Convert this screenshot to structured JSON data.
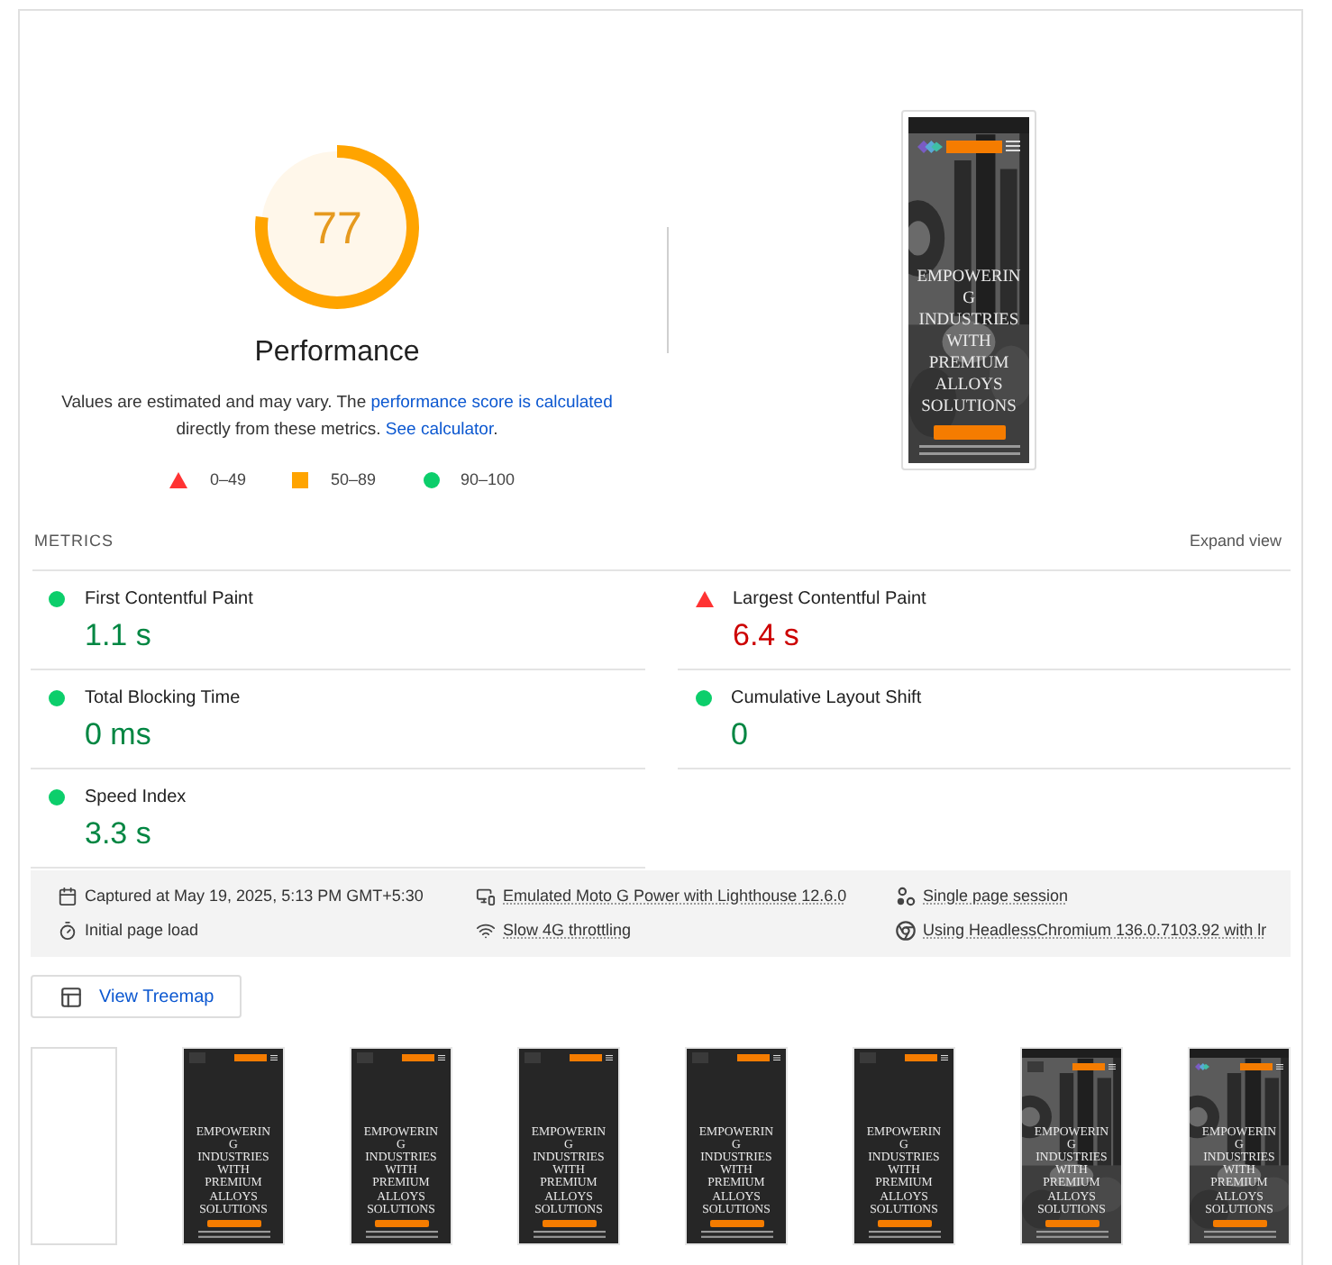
{
  "performance": {
    "score": "77",
    "level": 0.77,
    "title": "Performance",
    "description": {
      "text_before": "Values are estimated and may vary. The ",
      "link_1": "performance score is calculated",
      "text_middle": " directly from these metrics. ",
      "link_2": "See calculator",
      "text_after": "."
    },
    "legend": [
      {
        "kind": "fail",
        "label": "0–49"
      },
      {
        "kind": "average",
        "label": "50–89"
      },
      {
        "kind": "pass",
        "label": "90–100"
      }
    ]
  },
  "screenshot": {
    "logo": true,
    "heading": "EMPOWERIN\nG\nINDUSTRIES\nWITH\nPREMIUM\nALLOYS\nSOLUTIONS"
  },
  "metrics": {
    "title": "METRICS",
    "expand": "Expand view",
    "items": [
      {
        "label": "First Contentful Paint",
        "value": "1.1 s",
        "kind": "pass"
      },
      {
        "label": "Largest Contentful Paint",
        "value": "6.4 s",
        "kind": "fail"
      },
      {
        "label": "Total Blocking Time",
        "value": "0 ms",
        "kind": "pass"
      },
      {
        "label": "Cumulative Layout Shift",
        "value": "0",
        "kind": "pass"
      },
      {
        "label": "Speed Index",
        "value": "3.3 s",
        "kind": "pass"
      }
    ]
  },
  "info": [
    {
      "kind": "calendar",
      "text": "Captured at May 19, 2025, 5:13 PM GMT+5:30",
      "underlined": false
    },
    {
      "kind": "device",
      "text": "Emulated Moto G Power with Lighthouse 12.6.0",
      "underlined": true
    },
    {
      "kind": "nodes",
      "text": "Single page session",
      "underlined": true
    },
    {
      "kind": "timer",
      "text": "Initial page load",
      "underlined": false
    },
    {
      "kind": "wifi",
      "text": "Slow 4G throttling",
      "underlined": true
    },
    {
      "kind": "browser",
      "text": "Using HeadlessChromium 136.0.7103.92 with lr",
      "underlined": true
    }
  ],
  "treemap_button": "View Treemap",
  "filmstrip": [
    {
      "kind": "blank"
    },
    {
      "kind": "dark",
      "logo": false,
      "heading": "EMPOWERIN\nG\nINDUSTRIES\nWITH\nPREMIUM\nALLOYS\nSOLUTIONS"
    },
    {
      "kind": "dark",
      "logo": false,
      "heading": "EMPOWERIN\nG\nINDUSTRIES\nWITH\nPREMIUM\nALLOYS\nSOLUTIONS"
    },
    {
      "kind": "dark",
      "logo": false,
      "heading": "EMPOWERIN\nG\nINDUSTRIES\nWITH\nPREMIUM\nALLOYS\nSOLUTIONS"
    },
    {
      "kind": "dark",
      "logo": false,
      "heading": "EMPOWERIN\nG\nINDUSTRIES\nWITH\nPREMIUM\nALLOYS\nSOLUTIONS"
    },
    {
      "kind": "dark",
      "logo": false,
      "heading": "EMPOWERIN\nG\nINDUSTRIES\nWITH\nPREMIUM\nALLOYS\nSOLUTIONS"
    },
    {
      "logo": false,
      "heading": "EMPOWERIN\nG\nINDUSTRIES\nWITH\nPREMIUM\nALLOYS\nSOLUTIONS"
    },
    {
      "logo": true,
      "heading": "EMPOWERIN\nG\nINDUSTRIES\nWITH\nPREMIUM\nALLOYS\nSOLUTIONS"
    }
  ]
}
